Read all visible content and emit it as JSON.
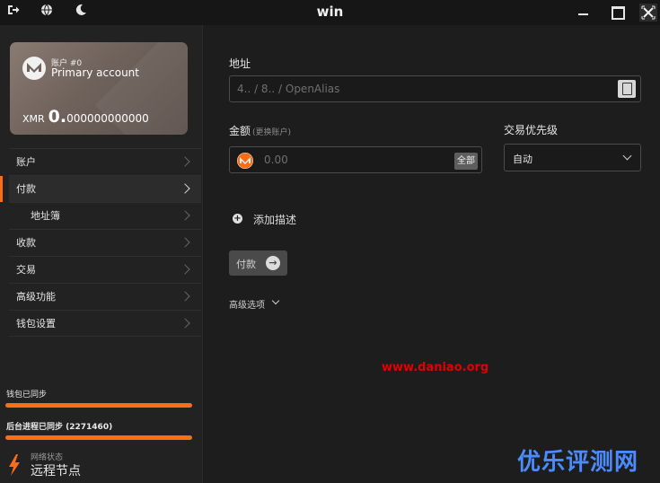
{
  "window": {
    "title": "win",
    "left_icons": [
      "logout-icon",
      "globe-icon",
      "moon-icon"
    ],
    "controls": [
      "minimize",
      "maximize",
      "close"
    ]
  },
  "account_card": {
    "label": "账户 #0",
    "name": "Primary account",
    "currency": "XMR",
    "balance_int": "0.",
    "balance_dec": "000000000000"
  },
  "menu": [
    {
      "label": "账户",
      "active": false,
      "sub": false
    },
    {
      "label": "付款",
      "active": true,
      "sub": false
    },
    {
      "label": "地址簿",
      "active": false,
      "sub": true
    },
    {
      "label": "收款",
      "active": false,
      "sub": false
    },
    {
      "label": "交易",
      "active": false,
      "sub": false
    },
    {
      "label": "高级功能",
      "active": false,
      "sub": false
    },
    {
      "label": "钱包设置",
      "active": false,
      "sub": false
    }
  ],
  "status": {
    "wallet_sync": "钱包已同步",
    "daemon_sync": "后台进程已同步 (2271460)",
    "network_label": "网络状态",
    "network_value": "远程节点",
    "wallet_sync_progress": 1.0,
    "daemon_sync_progress": 1.0
  },
  "send": {
    "address_label": "地址",
    "address_placeholder": "4.. / 8.. / OpenAlias",
    "amount_label": "金额",
    "amount_hint": "(更换账户)",
    "amount_placeholder": "0.00",
    "all_button": "全部",
    "priority_label": "交易优先级",
    "priority_value": "自动",
    "add_description": "添加描述",
    "send_button": "付款",
    "advanced_options": "高级选项"
  },
  "watermarks": {
    "url": "www.daniao.org",
    "brand": "优乐评测网"
  },
  "colors": {
    "accent": "#ff6c16",
    "background": "#1d1d1d",
    "sidebar": "#222222",
    "watermark_red": "#e00000",
    "watermark_blue": "#4a8cff"
  }
}
